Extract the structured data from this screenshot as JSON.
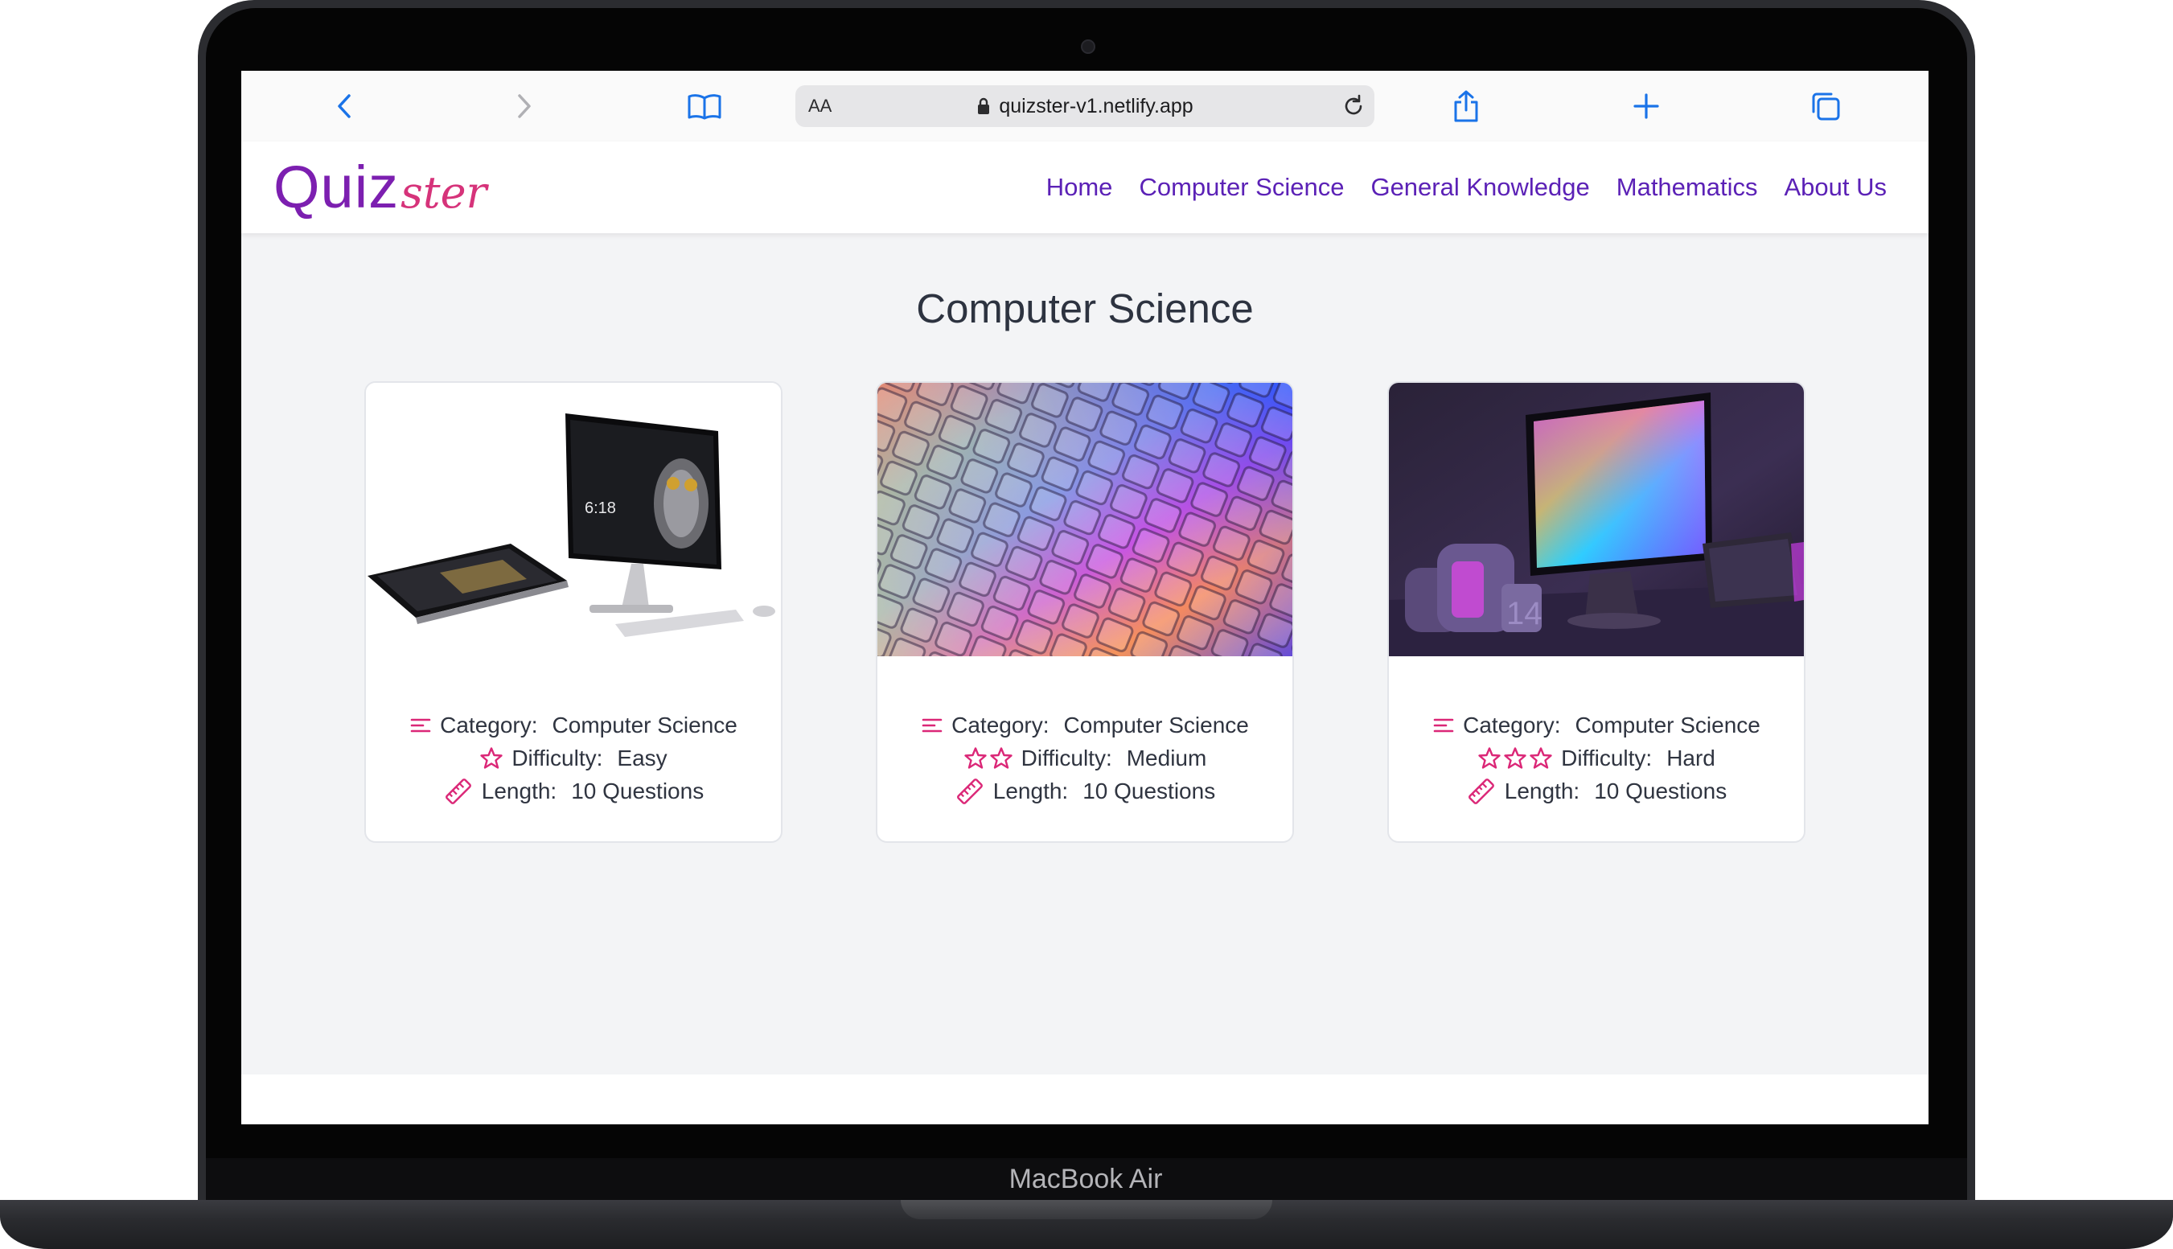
{
  "device": {
    "label": "MacBook Air"
  },
  "browser": {
    "text_size_label": "AA",
    "url": "quizster-v1.netlify.app"
  },
  "site": {
    "logo_main": "Quiz",
    "logo_script": "ster",
    "nav": [
      "Home",
      "Computer Science",
      "General Knowledge",
      "Mathematics",
      "About Us"
    ]
  },
  "page": {
    "title": "Computer Science"
  },
  "quizzes": [
    {
      "category_label": "Category:",
      "category": "Computer Science",
      "difficulty_label": "Difficulty:",
      "difficulty": "Easy",
      "stars": 1,
      "length_label": "Length:",
      "length": "10 Questions"
    },
    {
      "category_label": "Category:",
      "category": "Computer Science",
      "difficulty_label": "Difficulty:",
      "difficulty": "Medium",
      "stars": 2,
      "length_label": "Length:",
      "length": "10 Questions"
    },
    {
      "category_label": "Category:",
      "category": "Computer Science",
      "difficulty_label": "Difficulty:",
      "difficulty": "Hard",
      "stars": 3,
      "length_label": "Length:",
      "length": "10 Questions"
    }
  ],
  "colors": {
    "accent": "#5b21b6",
    "logo_primary": "#7c1fb0",
    "logo_secondary": "#d6337a",
    "icon": "#db2777"
  },
  "icons": [
    "back-icon",
    "forward-icon",
    "bookmarks-icon",
    "lock-icon",
    "reload-icon",
    "share-icon",
    "new-tab-icon",
    "tabs-icon",
    "category-icon",
    "star-icon",
    "ruler-icon"
  ]
}
